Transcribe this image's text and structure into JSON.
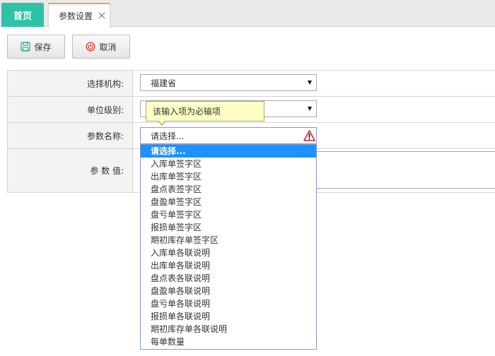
{
  "tabs": {
    "home_label": "首页",
    "param_label": "参数设置"
  },
  "toolbar": {
    "save_label": "保存",
    "cancel_label": "取消"
  },
  "form": {
    "org_label": "选择机构:",
    "org_value": "福建省",
    "level_label": "单位级别:",
    "level_value": "",
    "param_name_label": "参数名称:",
    "param_name_value": "请选择...",
    "param_value_label": "参 数 值:"
  },
  "tooltip": {
    "text": "该输入项为必输项"
  },
  "dropdown": {
    "options": [
      "请选择...",
      "入库单签字区",
      "出库单签字区",
      "盘点表签字区",
      "盘盈单签字区",
      "盘亏单签字区",
      "报损单签字区",
      "期初库存单签字区",
      "入库单各联说明",
      "出库单各联说明",
      "盘点表各联说明",
      "盘盈单各联说明",
      "盘亏单各联说明",
      "报损单各联说明",
      "期初库存单各联说明",
      "每单数量"
    ],
    "selected_index": 0
  },
  "colors": {
    "home_tab": "#2ec3a9",
    "active_tab_accent": "#f3a33a",
    "selected_option": "#1e90ff",
    "tooltip_bg": "#ffffc6"
  }
}
